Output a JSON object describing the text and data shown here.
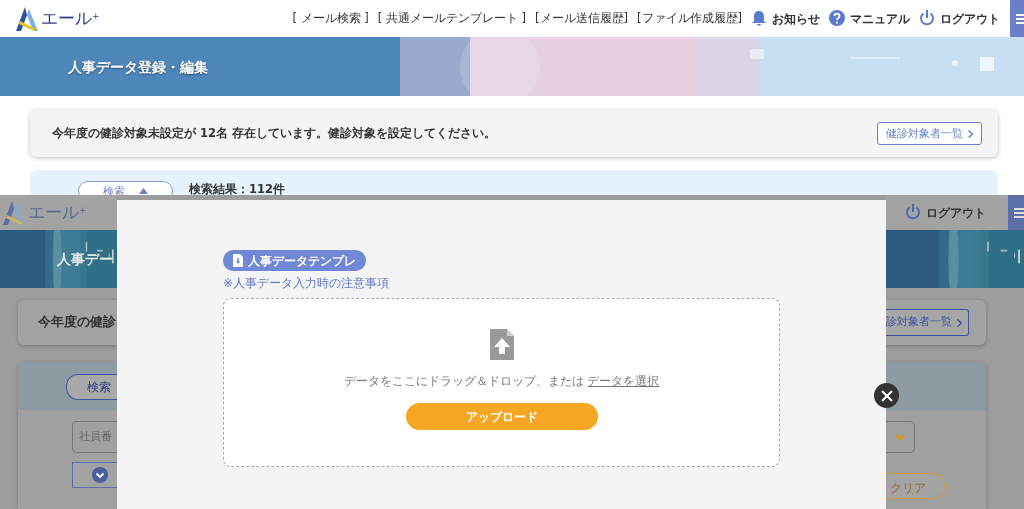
{
  "top_screen": {
    "header": {
      "logo": "エール$^{+}$",
      "nav_links": [
        "[ メール検索 ]",
        "[ 共通メールテンプレート ]",
        "[メール送信履歴]",
        "[ファイル作成履歴]"
      ],
      "actions": [
        {
          "kind": "bell",
          "label": "お知らせ"
        },
        {
          "kind": "help",
          "label": "マニュアル"
        },
        {
          "kind": "power",
          "label": "ログアウト"
        }
      ]
    },
    "banner": {
      "title": "人事データ登録・編集"
    },
    "alert": {
      "message": "今年度の健診対象未設定が 12名 存在しています。健診対象を設定してください。",
      "button": "健診対象者一覧"
    },
    "search_panel": {
      "toggle_button": "検索",
      "expanded": true,
      "result": "検索結果：112件"
    }
  },
  "background_screen": {
    "logo": "エール$^{+}$",
    "logout": "ログアウト",
    "banner_title": "人事デー",
    "alert_message": "今年度の健診",
    "alert_button": "診対象者一覧",
    "search_button": "検索",
    "employee_field_placeholder": "社員番",
    "clear_button": "クリア"
  },
  "modal": {
    "template_button": "人事データテンプレ",
    "note": "※人事データ入力時の注意事項",
    "dropzone": {
      "text": "データをここにドラッグ＆ドロップ、または",
      "link": "データを選択"
    },
    "upload_button": "アップロード"
  }
}
